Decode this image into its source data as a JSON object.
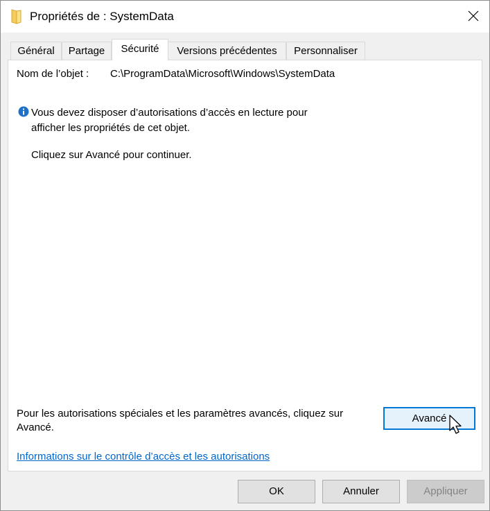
{
  "window": {
    "title": "Propriétés de : SystemData"
  },
  "tabs": [
    {
      "label": "Général",
      "active": false
    },
    {
      "label": "Partage",
      "active": false
    },
    {
      "label": "Sécurité",
      "active": true
    },
    {
      "label": "Versions précédentes",
      "active": false
    },
    {
      "label": "Personnaliser",
      "active": false
    }
  ],
  "security": {
    "object_name_label": "Nom de l’objet :",
    "object_name_value": "C:\\ProgramData\\Microsoft\\Windows\\SystemData",
    "info_line1": "Vous devez disposer d’autorisations d’accès en lecture pour",
    "info_line2": "afficher les propriétés de cet objet.",
    "continue_text": "Cliquez sur Avancé pour continuer.",
    "special_perms_line1": "Pour les autorisations spéciales et les paramètres avancés, cliquez sur",
    "special_perms_line2": "Avancé.",
    "advanced_button": "Avancé",
    "help_link": "Informations sur le contrôle d’accès et les autorisations"
  },
  "footer": {
    "ok": "OK",
    "cancel": "Annuler",
    "apply": "Appliquer"
  },
  "icons": {
    "title": "folder-icon",
    "info": "info-icon",
    "close": "close-icon",
    "cursor": "mouse-cursor-icon"
  },
  "colors": {
    "link": "#0066cc",
    "info_icon": "#1e70c9",
    "focus_border": "#0078d7",
    "folder": "#f6cd5c"
  }
}
